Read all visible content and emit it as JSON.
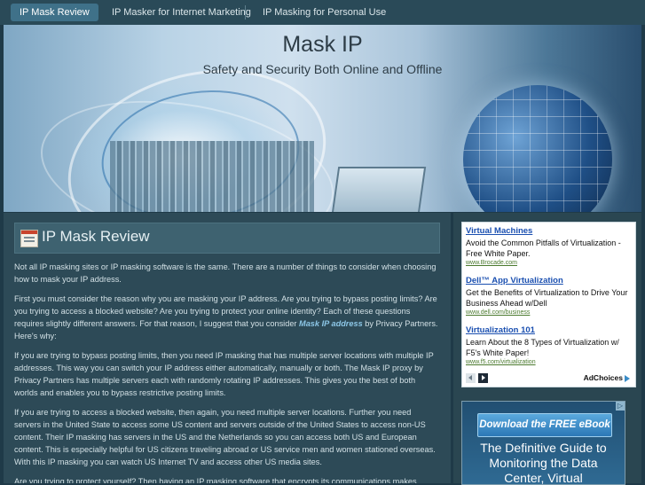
{
  "nav": {
    "items": [
      {
        "label": "IP Mask Review",
        "active": true
      },
      {
        "label": "IP Masker for Internet Marketing",
        "active": false
      },
      {
        "label": "IP Masking for Personal Use",
        "active": false
      }
    ]
  },
  "header": {
    "title": "Mask IP",
    "tagline": "Safety and Security Both Online and Offline"
  },
  "post": {
    "title": "IP Mask Review",
    "p1": "Not all IP masking sites or IP masking software is the same.  There are a number of things to consider when choosing how to mask your IP address.",
    "p2_before": "First you must consider the reason why you are masking your IP address.  Are you trying to bypass posting limits?  Are you trying to access a blocked website?  Are you trying to protect your online identity?  Each of these questions requires slightly different answers.  For that reason, I suggest that you consider ",
    "p2_link": "Mask IP address",
    "p2_after": " by Privacy Partners.  Here's why:",
    "p3": "If you are trying to bypass posting limits, then you need IP masking that has multiple server locations with multiple IP addresses.  This way you can switch your IP address either automatically, manually or both.  The Mask IP proxy by Privacy Partners has multiple servers each with randomly rotating IP addresses.  This gives you the best of both worlds and enables you to bypass restrictive posting limits.",
    "p4": "If you are trying to access a blocked website, then again, you need multiple server locations.  Further you need servers in the United State to access some US content and servers outside of the United States to access non-US content.  Their IP masking has servers in the US and the Netherlands so you can access both US and European content.  This is especially helpful for US citizens traveling abroad or US service men and women stationed overseas.  With this IP masking you can watch US Internet TV and access other US media sites.",
    "p5": "Are you trying to protect yourself?  Then having an IP masking software that encrypts its communications makes"
  },
  "ads": {
    "items": [
      {
        "title": "Virtual Machines",
        "desc": "Avoid the Common Pitfalls of Virtualization - Free White Paper.",
        "url": "www.Brocade.com"
      },
      {
        "title": "Dell™ App Virtualization",
        "desc": "Get the Benefits of Virtualization to Drive Your Business Ahead w/Dell",
        "url": "www.dell.com/business"
      },
      {
        "title": "Virtualization 101",
        "desc": "Learn About the 8 Types of Virtualization w/ F5's White Paper!",
        "url": "www.f5.com/virtualization"
      }
    ],
    "adchoices_label": "AdChoices"
  },
  "ebook": {
    "button_label": "Download the FREE eBook",
    "heading_line1": "The Definitive Guide to",
    "heading_line2": "Monitoring the Data",
    "heading_line3": "Center, Virtual"
  }
}
